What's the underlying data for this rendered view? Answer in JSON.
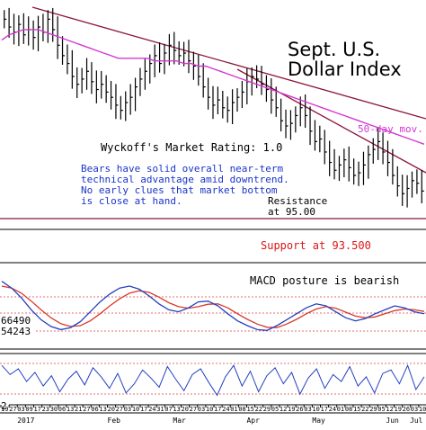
{
  "chart_data": [
    {
      "type": "ohlc",
      "title_line1": "Sept. U.S.",
      "title_line2": "Dollar Index",
      "wyckoff_rating": "Wyckoff's Market Rating: 1.0",
      "commentary": [
        "Bears have solid overall near-term",
        "technical advantage amid downtrend.",
        "No early clues that market bottom",
        "is close at hand."
      ],
      "resistance_line1": "Resistance",
      "resistance_line2": "at 95.00",
      "support_label": "Support at 93.500",
      "moving_average_label": "50-day mov.",
      "y_range": [
        93.0,
        101.5
      ],
      "resistance_level": 95.0,
      "support_level": 93.5,
      "closes": [
        100.9,
        100.6,
        100.4,
        100.7,
        100.3,
        100.5,
        100.2,
        100.6,
        100.4,
        100.9,
        100.5,
        99.9,
        99.5,
        99.2,
        98.7,
        98.4,
        98.6,
        98.9,
        98.5,
        98.2,
        98.4,
        98.1,
        97.9,
        97.6,
        97.4,
        97.7,
        97.9,
        98.3,
        98.6,
        98.9,
        99.2,
        99.5,
        99.2,
        99.6,
        99.9,
        99.7,
        99.5,
        99.6,
        99.3,
        99.1,
        98.7,
        98.3,
        97.9,
        97.6,
        97.8,
        97.5,
        97.4,
        97.7,
        97.9,
        98.1,
        98.5,
        98.7,
        98.6,
        98.4,
        98.2,
        97.8,
        97.5,
        97.0,
        96.8,
        96.9,
        97.2,
        97.5,
        97.2,
        96.6,
        96.2,
        96.3,
        95.8,
        95.4,
        95.1,
        95.3,
        95.5,
        95.2,
        94.9,
        95.0,
        95.3,
        95.7,
        95.9,
        96.2,
        95.8,
        95.4,
        94.9,
        94.5,
        94.2,
        94.4,
        94.7,
        94.6,
        94.3
      ],
      "moving_average_50day": [
        100.1,
        100.3,
        100.4,
        100.5,
        100.5,
        100.5,
        100.4,
        100.3,
        100.2,
        100.1,
        100.0,
        99.9,
        99.8,
        99.7,
        99.6,
        99.5,
        99.4,
        99.4,
        99.4,
        99.4,
        99.4,
        99.3,
        99.3,
        99.3,
        99.3,
        99.2,
        99.2,
        99.1,
        99.1,
        99.0,
        98.9,
        98.8,
        98.7,
        98.6,
        98.5,
        98.4,
        98.3,
        98.2,
        98.1,
        98.0,
        97.9,
        97.8,
        97.7,
        97.6,
        97.5,
        97.4,
        97.3,
        97.2,
        97.1,
        97.0,
        96.9,
        96.8,
        96.7,
        96.6,
        96.5,
        96.4,
        96.3,
        96.2,
        96.1
      ]
    },
    {
      "type": "line",
      "name": "macd",
      "annotation": "MACD posture is bearish",
      "readout_values": [
        "66490",
        "54243"
      ],
      "series": [
        {
          "name": "blue",
          "color": "#2440c0",
          "values": [
            0.62,
            0.45,
            0.2,
            -0.1,
            -0.35,
            -0.52,
            -0.6,
            -0.55,
            -0.4,
            -0.15,
            0.1,
            0.3,
            0.45,
            0.5,
            0.42,
            0.25,
            0.05,
            -0.1,
            -0.15,
            -0.05,
            0.1,
            0.12,
            0.0,
            -0.2,
            -0.38,
            -0.5,
            -0.6,
            -0.62,
            -0.5,
            -0.35,
            -0.2,
            -0.05,
            0.05,
            0.0,
            -0.15,
            -0.3,
            -0.38,
            -0.32,
            -0.2,
            -0.1,
            0.0,
            -0.05,
            -0.15,
            -0.2
          ]
        },
        {
          "name": "red",
          "color": "#d83a2a",
          "values": [
            0.5,
            0.45,
            0.32,
            0.12,
            -0.1,
            -0.3,
            -0.45,
            -0.52,
            -0.5,
            -0.38,
            -0.2,
            0.0,
            0.18,
            0.32,
            0.38,
            0.34,
            0.22,
            0.08,
            -0.02,
            -0.06,
            -0.02,
            0.04,
            0.05,
            -0.05,
            -0.2,
            -0.34,
            -0.46,
            -0.54,
            -0.55,
            -0.46,
            -0.34,
            -0.2,
            -0.08,
            -0.02,
            -0.06,
            -0.16,
            -0.26,
            -0.3,
            -0.28,
            -0.2,
            -0.12,
            -0.08,
            -0.1,
            -0.14
          ]
        }
      ],
      "y_range": [
        -1,
        1
      ]
    },
    {
      "type": "line",
      "name": "oscillator",
      "readout_value": "2",
      "series": [
        {
          "name": "blue",
          "color": "#2440c0",
          "values": [
            0.6,
            0.2,
            0.45,
            -0.1,
            0.3,
            -0.3,
            0.15,
            -0.55,
            0.0,
            0.35,
            -0.25,
            0.5,
            0.1,
            -0.4,
            0.25,
            -0.6,
            -0.2,
            0.4,
            0.05,
            -0.35,
            0.55,
            0.0,
            -0.5,
            0.2,
            0.45,
            -0.15,
            -0.7,
            0.1,
            0.6,
            -0.3,
            0.35,
            -0.55,
            0.15,
            0.5,
            -0.2,
            0.3,
            -0.65,
            0.05,
            0.45,
            -0.4,
            0.2,
            -0.1,
            0.55,
            -0.3,
            0.1,
            -0.6,
            0.25,
            0.4,
            -0.2,
            0.6,
            -0.45,
            0.1
          ]
        }
      ],
      "y_range": [
        -1,
        1
      ]
    }
  ],
  "x_axis": {
    "day_labels": [
      "19",
      "27",
      "03",
      "09",
      "17",
      "23",
      "30",
      "06",
      "13",
      "21",
      "27",
      "06",
      "13",
      "20",
      "27",
      "03",
      "10",
      "17",
      "24",
      "31",
      "07",
      "13",
      "20",
      "27",
      "03",
      "10",
      "17",
      "24",
      "01",
      "08",
      "15",
      "22",
      "29",
      "05",
      "12",
      "19",
      "26",
      "03",
      "10",
      "17",
      "24",
      "01",
      "08",
      "15",
      "22",
      "29",
      "05",
      "12",
      "19",
      "26",
      "03",
      "10"
    ],
    "month_labels": [
      "2017",
      "Feb",
      "Mar",
      "Apr",
      "May",
      "Jun",
      "Jul"
    ]
  },
  "colors": {
    "price_bars": "#000000",
    "moving_average": "#d437d4",
    "trendline": "#8b1538",
    "commentary": "#1a35c8",
    "support": "#d81818",
    "reference_lines": "#e07070"
  }
}
